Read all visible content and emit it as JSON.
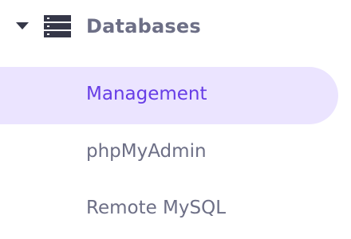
{
  "section": {
    "title": "Databases",
    "expanded": true,
    "icon": "database-icon",
    "caret_icon": "caret-down-icon"
  },
  "items": [
    {
      "label": "Management",
      "active": true
    },
    {
      "label": "phpMyAdmin",
      "active": false
    },
    {
      "label": "Remote MySQL",
      "active": false
    }
  ],
  "colors": {
    "text": "#6d6f86",
    "icon": "#353748",
    "active_text": "#673de6",
    "active_bg": "#ebe4ff"
  }
}
